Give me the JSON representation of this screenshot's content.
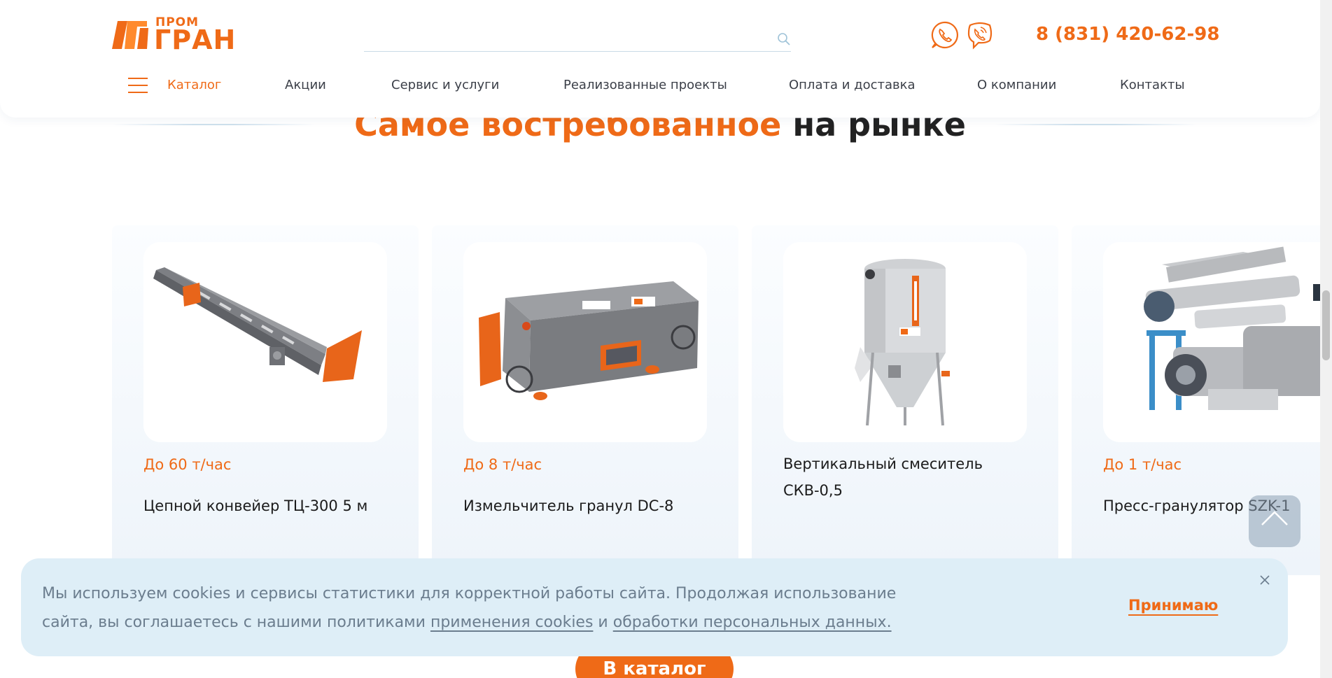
{
  "header": {
    "logo_small": "ПРОМ",
    "logo_big": "ГРАН",
    "search_placeholder": "",
    "phone": "8 (831) 420-62-98"
  },
  "nav": {
    "items": [
      {
        "label": "Каталог"
      },
      {
        "label": "Акции"
      },
      {
        "label": "Сервис и услуги"
      },
      {
        "label": "Реализованные проекты"
      },
      {
        "label": "Оплата и доставка"
      },
      {
        "label": "О компании"
      },
      {
        "label": "Контакты"
      }
    ]
  },
  "section": {
    "title_accent": "Самое востребованное",
    "title_rest": " на рынке"
  },
  "products": [
    {
      "capacity": "До 60 т/час",
      "name": "Цепной конвейер ТЦ-300 5 м"
    },
    {
      "capacity": "До 8 т/час",
      "name": "Измельчитель гранул DC-8"
    },
    {
      "capacity": "",
      "name": "Вертикальный смеситель СКВ-0,5"
    },
    {
      "capacity": "До 1 т/час",
      "name": "Пресс-гранулятор SZK-1"
    }
  ],
  "catalog_button": "В каталог",
  "cookie": {
    "text_part1": "Мы используем cookies и сервисы статистики для корректной работы сайта. Продолжая использование сайта, вы соглашаетесь с нашими политиками ",
    "link1": "применения cookies",
    "text_part2": " и ",
    "link2": "обработки персональных данных.",
    "accept": "Принимаю"
  },
  "colors": {
    "accent": "#ef6a17",
    "cookie_bg": "#deeef7"
  }
}
